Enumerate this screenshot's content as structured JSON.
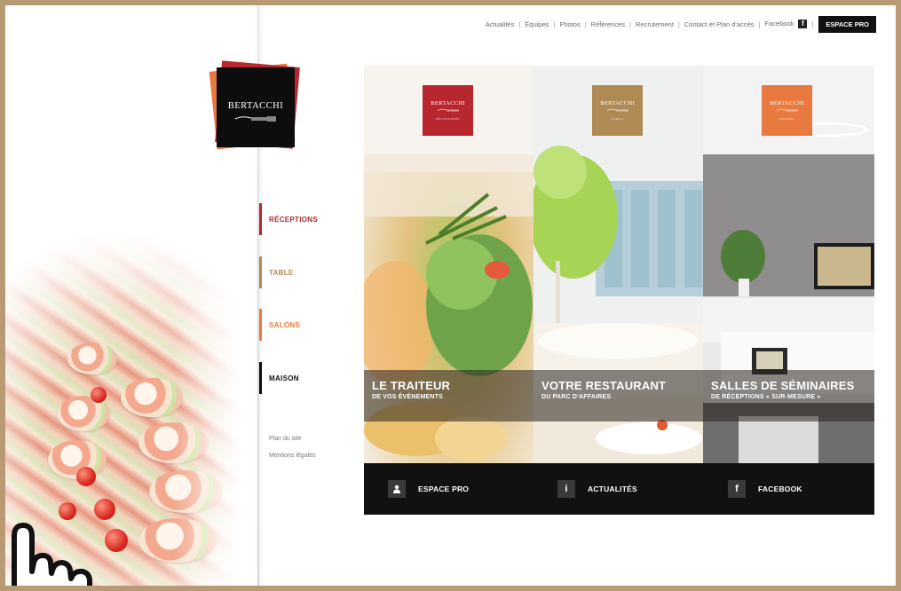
{
  "topnav": {
    "items": [
      "Actualités",
      "Équipes",
      "Photos",
      "Références",
      "Recrutement",
      "Contact et Plan d'accès",
      "Facebook"
    ],
    "facebook_icon": "f",
    "espace_pro": "ESPACE PRO"
  },
  "logo": {
    "name": "Bertacchi"
  },
  "nav": {
    "items": [
      {
        "label": "RÉCEPTIONS",
        "color": "#b8262e"
      },
      {
        "label": "TABLE",
        "color": "#b08a55"
      },
      {
        "label": "SALONS",
        "color": "#e8793f"
      },
      {
        "label": "MAISON",
        "color": "#111111"
      }
    ],
    "links": [
      "Plan du site",
      "Mentions légales"
    ]
  },
  "panels": [
    {
      "badge_name": "Bertacchi",
      "badge_sub": "RÉCEPTIONS",
      "badge_color": "#b8262e",
      "title": "LE TRAITEUR",
      "subtitle": "DE VOS ÉVÈNEMENTS"
    },
    {
      "badge_name": "Bertacchi",
      "badge_sub": "TABLE",
      "badge_color": "#b08a55",
      "title": "VOTRE RESTAURANT",
      "subtitle": "DU PARC D'AFFAIRES"
    },
    {
      "badge_name": "Bertacchi",
      "badge_sub": "SALONS",
      "badge_color": "#e8793f",
      "title": "SALLES DE SÉMINAIRES",
      "subtitle": "DE RÉCEPTIONS « SUR-MESURE »"
    }
  ],
  "bottom_bar": [
    {
      "icon": "user-icon",
      "label": "ESPACE PRO"
    },
    {
      "icon": "info-icon",
      "label": "ACTUALITÉS"
    },
    {
      "icon": "facebook-icon",
      "label": "FACEBOOK"
    }
  ],
  "colors": {
    "frame": "#b89a74",
    "bottom_bar": "#111111"
  }
}
